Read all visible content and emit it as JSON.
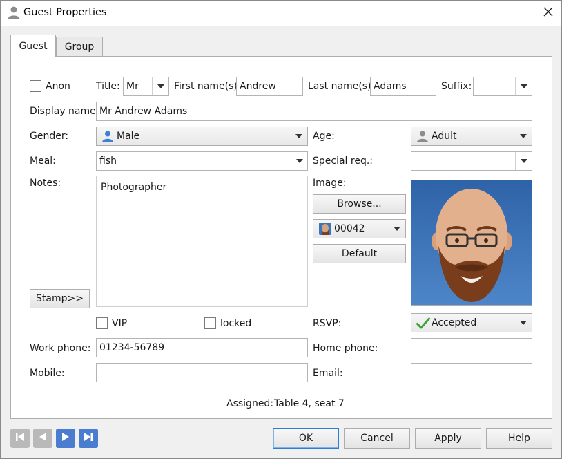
{
  "window": {
    "title": "Guest Properties"
  },
  "tabs": [
    {
      "label": "Guest"
    },
    {
      "label": "Group"
    }
  ],
  "guest": {
    "anon_label": "Anon",
    "title_label": "Title:",
    "title_value": "Mr",
    "first_name_label": "First name(s):",
    "first_name_value": "Andrew",
    "last_name_label": "Last name(s):",
    "last_name_value": "Adams",
    "suffix_label": "Suffix:",
    "suffix_value": "",
    "display_name_label": "Display name:",
    "display_name_value": "Mr Andrew Adams",
    "gender_label": "Gender:",
    "gender_value": "Male",
    "age_label": "Age:",
    "age_value": "Adult",
    "meal_label": "Meal:",
    "meal_value": "fish",
    "special_req_label": "Special req.:",
    "special_req_value": "",
    "notes_label": "Notes:",
    "notes_value": "Photographer",
    "image_label": "Image:",
    "browse_label": "Browse...",
    "image_id_value": "00042",
    "default_label": "Default",
    "stamp_label": "Stamp>>",
    "vip_label": "VIP",
    "locked_label": "locked",
    "rsvp_label": "RSVP:",
    "rsvp_value": "Accepted",
    "work_phone_label": "Work phone:",
    "work_phone_value": "01234-56789",
    "home_phone_label": "Home phone:",
    "home_phone_value": "",
    "mobile_label": "Mobile:",
    "mobile_value": "",
    "email_label": "Email:",
    "email_value": "",
    "assigned_label": "Assigned:",
    "assigned_value": "Table 4, seat 7"
  },
  "buttons": {
    "ok": "OK",
    "cancel": "Cancel",
    "apply": "Apply",
    "help": "Help"
  },
  "colors": {
    "accent": "#4a7ccf",
    "default_button_border": "#2d7dd2",
    "accepted_check": "#3aa23a",
    "person_icon_male": "#3b7fd6",
    "person_icon_gray": "#8c8c8c"
  }
}
